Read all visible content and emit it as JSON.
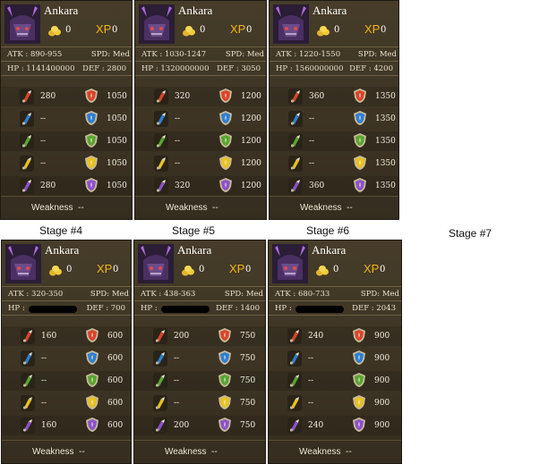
{
  "cards": [
    {
      "name": "Ankara",
      "gold": "0",
      "xp_label": "XP",
      "xp": "0",
      "atk": "ATK : 890-955",
      "spd": "SPD: Med",
      "hp": "HP : 1141400000",
      "def": "DEF : 2800",
      "redacted": false,
      "rows": [
        {
          "atk": "280",
          "def": "1050"
        },
        {
          "atk": "--",
          "def": "1050"
        },
        {
          "atk": "--",
          "def": "1050"
        },
        {
          "atk": "--",
          "def": "1050"
        },
        {
          "atk": "280",
          "def": "1050"
        }
      ],
      "weakness_label": "Weakness",
      "weakness": "--"
    },
    {
      "name": "Ankara",
      "gold": "0",
      "xp_label": "XP",
      "xp": "0",
      "atk": "ATK : 1030-1247",
      "spd": "SPD: Med",
      "hp": "HP : 1320000000",
      "def": "DEF : 3050",
      "redacted": false,
      "rows": [
        {
          "atk": "320",
          "def": "1200"
        },
        {
          "atk": "--",
          "def": "1200"
        },
        {
          "atk": "--",
          "def": "1200"
        },
        {
          "atk": "--",
          "def": "1200"
        },
        {
          "atk": "320",
          "def": "1200"
        }
      ],
      "weakness_label": "Weakness",
      "weakness": "--"
    },
    {
      "name": "Ankara",
      "gold": "0",
      "xp_label": "XP",
      "xp": "0",
      "atk": "ATK : 1220-1550",
      "spd": "SPD: Med",
      "hp": "HP : 1560000000",
      "def": "DEF : 4200",
      "redacted": false,
      "rows": [
        {
          "atk": "360",
          "def": "1350"
        },
        {
          "atk": "--",
          "def": "1350"
        },
        {
          "atk": "--",
          "def": "1350"
        },
        {
          "atk": "--",
          "def": "1350"
        },
        {
          "atk": "360",
          "def": "1350"
        }
      ],
      "weakness_label": "Weakness",
      "weakness": "--"
    },
    {
      "name": "Ankara",
      "gold": "0",
      "xp_label": "XP",
      "xp": "0",
      "atk": "ATK : 320-350",
      "spd": "SPD: Med",
      "hp": "HP :",
      "def": "DEF : 700",
      "redacted": true,
      "rows": [
        {
          "atk": "160",
          "def": "600"
        },
        {
          "atk": "--",
          "def": "600"
        },
        {
          "atk": "--",
          "def": "600"
        },
        {
          "atk": "--",
          "def": "600"
        },
        {
          "atk": "160",
          "def": "600"
        }
      ],
      "weakness_label": "Weakness",
      "weakness": "--"
    },
    {
      "name": "Ankara",
      "gold": "0",
      "xp_label": "XP",
      "xp": "0",
      "atk": "ATK : 438-363",
      "spd": "SPD: Med",
      "hp": "HP :",
      "def": "DEF : 1400",
      "redacted": true,
      "rows": [
        {
          "atk": "200",
          "def": "750"
        },
        {
          "atk": "--",
          "def": "750"
        },
        {
          "atk": "--",
          "def": "750"
        },
        {
          "atk": "--",
          "def": "750"
        },
        {
          "atk": "200",
          "def": "750"
        }
      ],
      "weakness_label": "Weakness",
      "weakness": "--"
    },
    {
      "name": "Ankara",
      "gold": "0",
      "xp_label": "XP",
      "xp": "0",
      "atk": "ATK : 680-733",
      "spd": "SPD: Med",
      "hp": "HP :",
      "def": "DEF : 2043",
      "redacted": true,
      "rows": [
        {
          "atk": "240",
          "def": "900"
        },
        {
          "atk": "--",
          "def": "900"
        },
        {
          "atk": "--",
          "def": "900"
        },
        {
          "atk": "--",
          "def": "900"
        },
        {
          "atk": "240",
          "def": "900"
        }
      ],
      "weakness_label": "Weakness",
      "weakness": "--"
    }
  ],
  "stage_labels": [
    "Stage #4",
    "Stage #5",
    "Stage #6",
    "Stage #7"
  ],
  "colors": {
    "card_bg": "#3b3323",
    "xp": "#f2b416",
    "fire": "#d9442a",
    "water": "#2d7fd0",
    "nature": "#5aa531",
    "light": "#e8c21e",
    "dark": "#8a52c8"
  },
  "icons": {
    "row_attack": [
      "fire-attack-icon",
      "water-attack-icon",
      "nature-attack-icon",
      "light-attack-icon",
      "dark-attack-icon"
    ],
    "row_defense": [
      "fire-shield-icon",
      "water-shield-icon",
      "nature-shield-icon",
      "light-shield-icon",
      "dark-shield-icon"
    ]
  }
}
